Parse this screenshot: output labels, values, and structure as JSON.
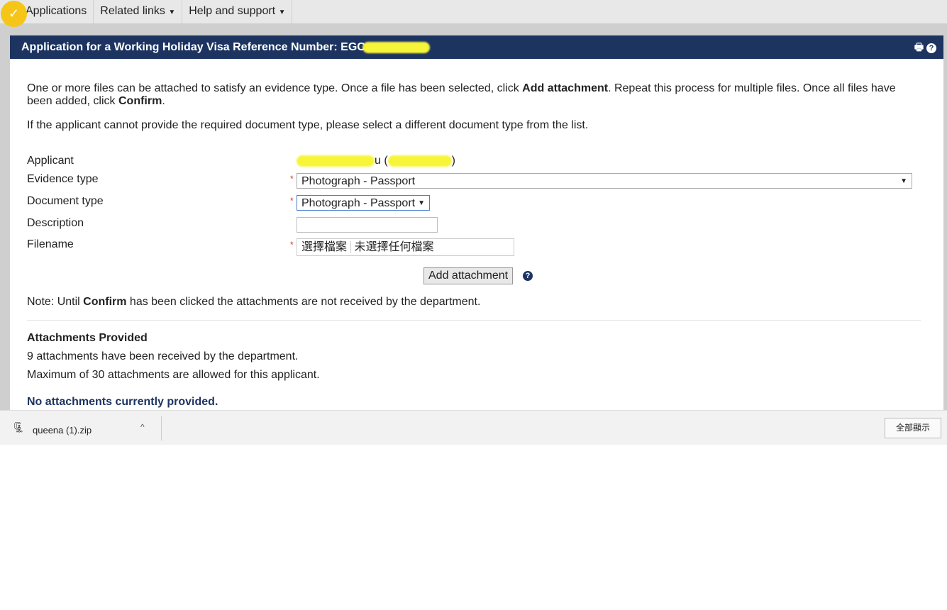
{
  "topnav": {
    "items": [
      "Applications",
      "Related links",
      "Help and support"
    ]
  },
  "header": {
    "title": "Application for a Working Holiday Visa Reference Number: EGC"
  },
  "intro": {
    "p1_a": "One or more files can be attached to satisfy an evidence type. Once a file has been selected, click ",
    "p1_b": "Add attachment",
    "p1_c": ". Repeat this process for multiple files. Once all files have been added, click ",
    "p1_d": "Confirm",
    "p1_e": ".",
    "p2": "If the applicant cannot provide the required document type, please select a different document type from the list."
  },
  "form": {
    "applicant_label": "Applicant",
    "applicant_visible": "u (",
    "applicant_close": ")",
    "evidence_label": "Evidence type",
    "evidence_value": "Photograph - Passport",
    "document_label": "Document type",
    "document_value": "Photograph - Passport",
    "description_label": "Description",
    "description_value": "",
    "filename_label": "Filename",
    "choose_file": "選擇檔案",
    "no_file": "未選擇任何檔案",
    "add_attachment": "Add attachment"
  },
  "note": {
    "a": "Note: Until ",
    "b": "Confirm",
    "c": " has been clicked the attachments are not received by the department."
  },
  "attachments": {
    "title": "Attachments Provided",
    "received": "9 attachments have been received by the department.",
    "maximum": "Maximum of 30 attachments are allowed for this applicant.",
    "none": "No attachments currently provided."
  },
  "downloads": {
    "file": "queena (1).zip",
    "show_all": "全部顯示"
  }
}
